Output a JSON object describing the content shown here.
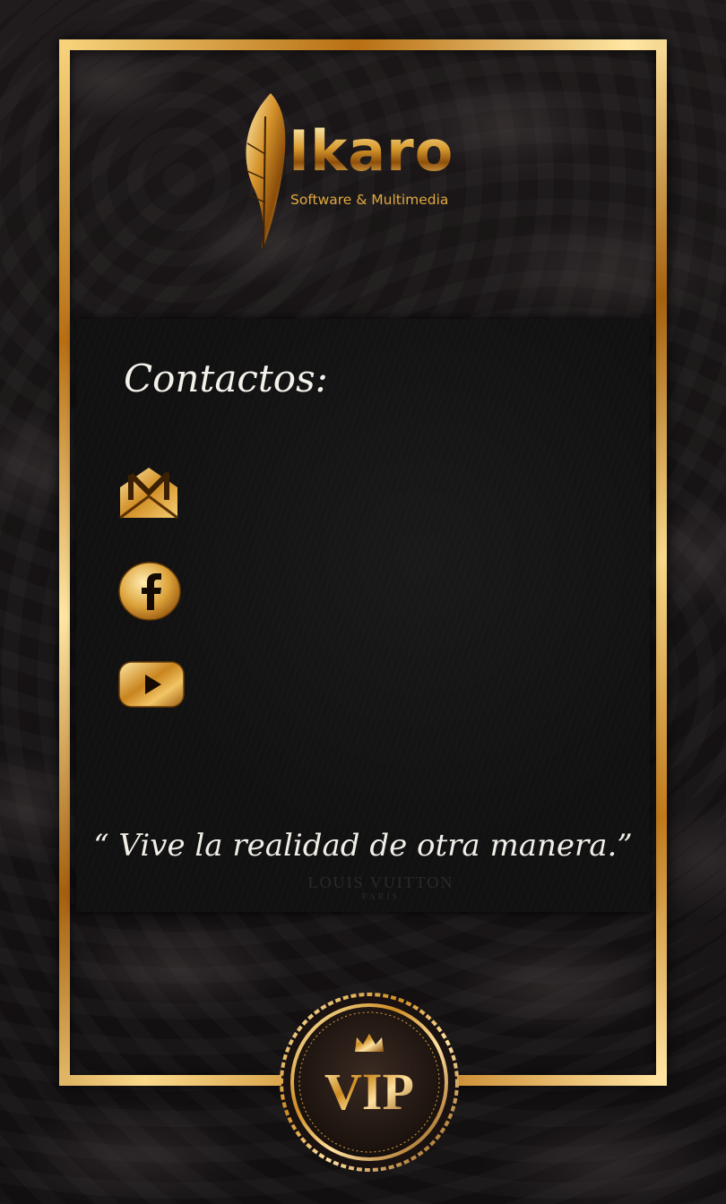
{
  "brand": {
    "name": "Ikaro",
    "tagline": "Software & Multimedia"
  },
  "contacts": {
    "title": "Contactos:",
    "items": [
      {
        "icon": "gmail-icon"
      },
      {
        "icon": "facebook-icon"
      },
      {
        "icon": "youtube-icon"
      }
    ]
  },
  "quote": "“ Vive la realidad de otra manera.”",
  "watermark": {
    "line1": "LOUIS VUITTON",
    "line2": "PARIS"
  },
  "badge": {
    "label": "VIP"
  },
  "colors": {
    "gold_light": "#ffe7a3",
    "gold_dark": "#a5600d",
    "panel": "#111111",
    "background": "#141112"
  }
}
